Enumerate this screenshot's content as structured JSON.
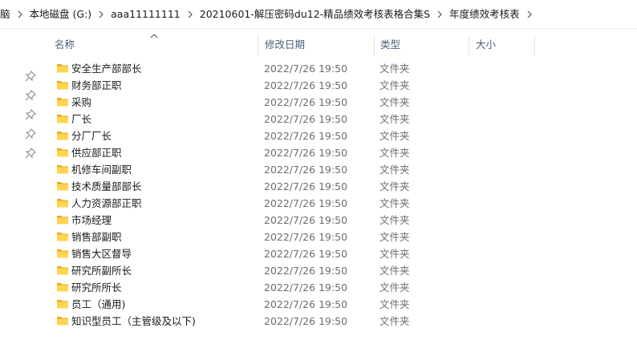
{
  "breadcrumb": [
    "脑",
    "本地磁盘 (G:)",
    "aaa11111111",
    "20210601-解压密码du12-精品绩效考核表格合集S",
    "年度绩效考核表"
  ],
  "columns": {
    "name": "名称",
    "date_modified": "修改日期",
    "type": "类型",
    "size": "大小"
  },
  "files": [
    {
      "name": "安全生产部部长",
      "date": "2022/7/26 19:50",
      "type": "文件夹"
    },
    {
      "name": "财务部正职",
      "date": "2022/7/26 19:50",
      "type": "文件夹"
    },
    {
      "name": "采购",
      "date": "2022/7/26 19:50",
      "type": "文件夹"
    },
    {
      "name": "厂长",
      "date": "2022/7/26 19:50",
      "type": "文件夹"
    },
    {
      "name": "分厂厂长",
      "date": "2022/7/26 19:50",
      "type": "文件夹"
    },
    {
      "name": "供应部正职",
      "date": "2022/7/26 19:50",
      "type": "文件夹"
    },
    {
      "name": "机修车间副职",
      "date": "2022/7/26 19:50",
      "type": "文件夹"
    },
    {
      "name": "技术质量部部长",
      "date": "2022/7/26 19:50",
      "type": "文件夹"
    },
    {
      "name": "人力资源部正职",
      "date": "2022/7/26 19:50",
      "type": "文件夹"
    },
    {
      "name": "市场经理",
      "date": "2022/7/26 19:50",
      "type": "文件夹"
    },
    {
      "name": "销售部副职",
      "date": "2022/7/26 19:50",
      "type": "文件夹"
    },
    {
      "name": "销售大区督导",
      "date": "2022/7/26 19:50",
      "type": "文件夹"
    },
    {
      "name": "研究所副所长",
      "date": "2022/7/26 19:50",
      "type": "文件夹"
    },
    {
      "name": "研究所所长",
      "date": "2022/7/26 19:50",
      "type": "文件夹"
    },
    {
      "name": "员工（通用)",
      "date": "2022/7/26 19:50",
      "type": "文件夹"
    },
    {
      "name": "知识型员工（主管级及以下)",
      "date": "2022/7/26 19:50",
      "type": "文件夹"
    }
  ],
  "icons": {
    "folder": "folder-icon",
    "pin": "pin-icon",
    "separator": "chevron-right-icon",
    "sort": "sort-ascending-icon"
  },
  "colors": {
    "header_text": "#4c607a",
    "folder_fill": "#ffd44f",
    "folder_back": "#e8a920",
    "secondary_text": "#6d6d6d"
  }
}
